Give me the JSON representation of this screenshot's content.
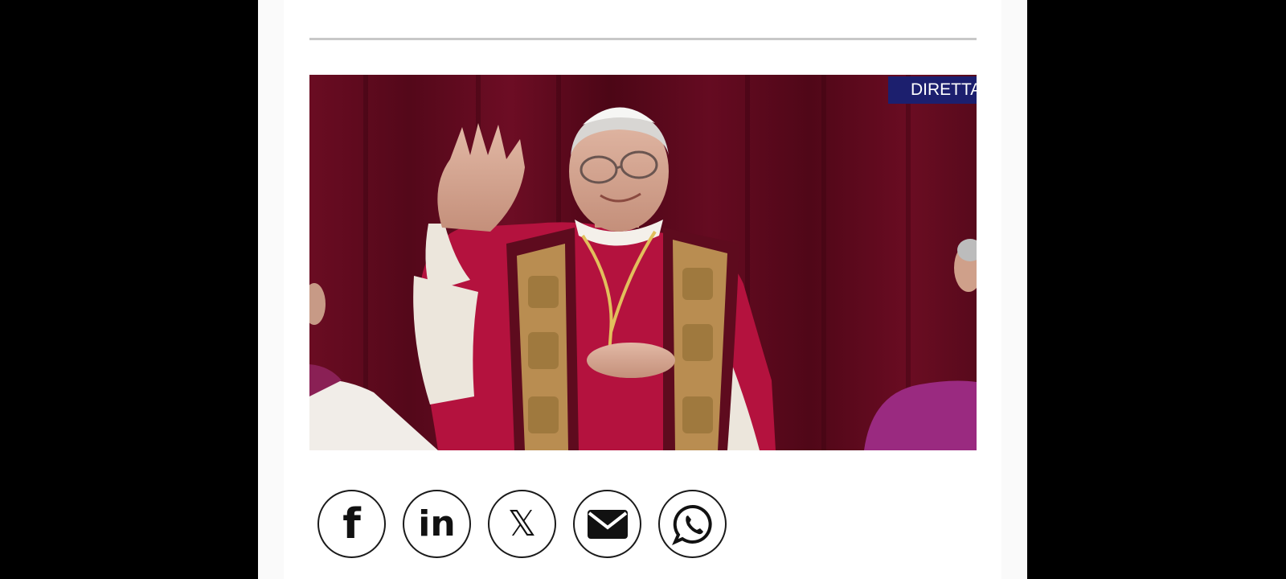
{
  "article": {
    "image": {
      "live_badge": "DIRETTA",
      "alt": "",
      "colors": {
        "curtain": "#5b0a1c",
        "vestment": "#b4123e",
        "stole_gold": "#c9a45a",
        "badge": "#1c1f6e"
      }
    }
  },
  "share": {
    "buttons": [
      {
        "name": "facebook",
        "icon": "facebook-icon",
        "glyph": "f"
      },
      {
        "name": "linkedin",
        "icon": "linkedin-icon",
        "glyph": "in"
      },
      {
        "name": "x",
        "icon": "x-icon",
        "glyph": "𝕏"
      },
      {
        "name": "email",
        "icon": "envelope-icon"
      },
      {
        "name": "whatsapp",
        "icon": "whatsapp-icon"
      }
    ]
  }
}
